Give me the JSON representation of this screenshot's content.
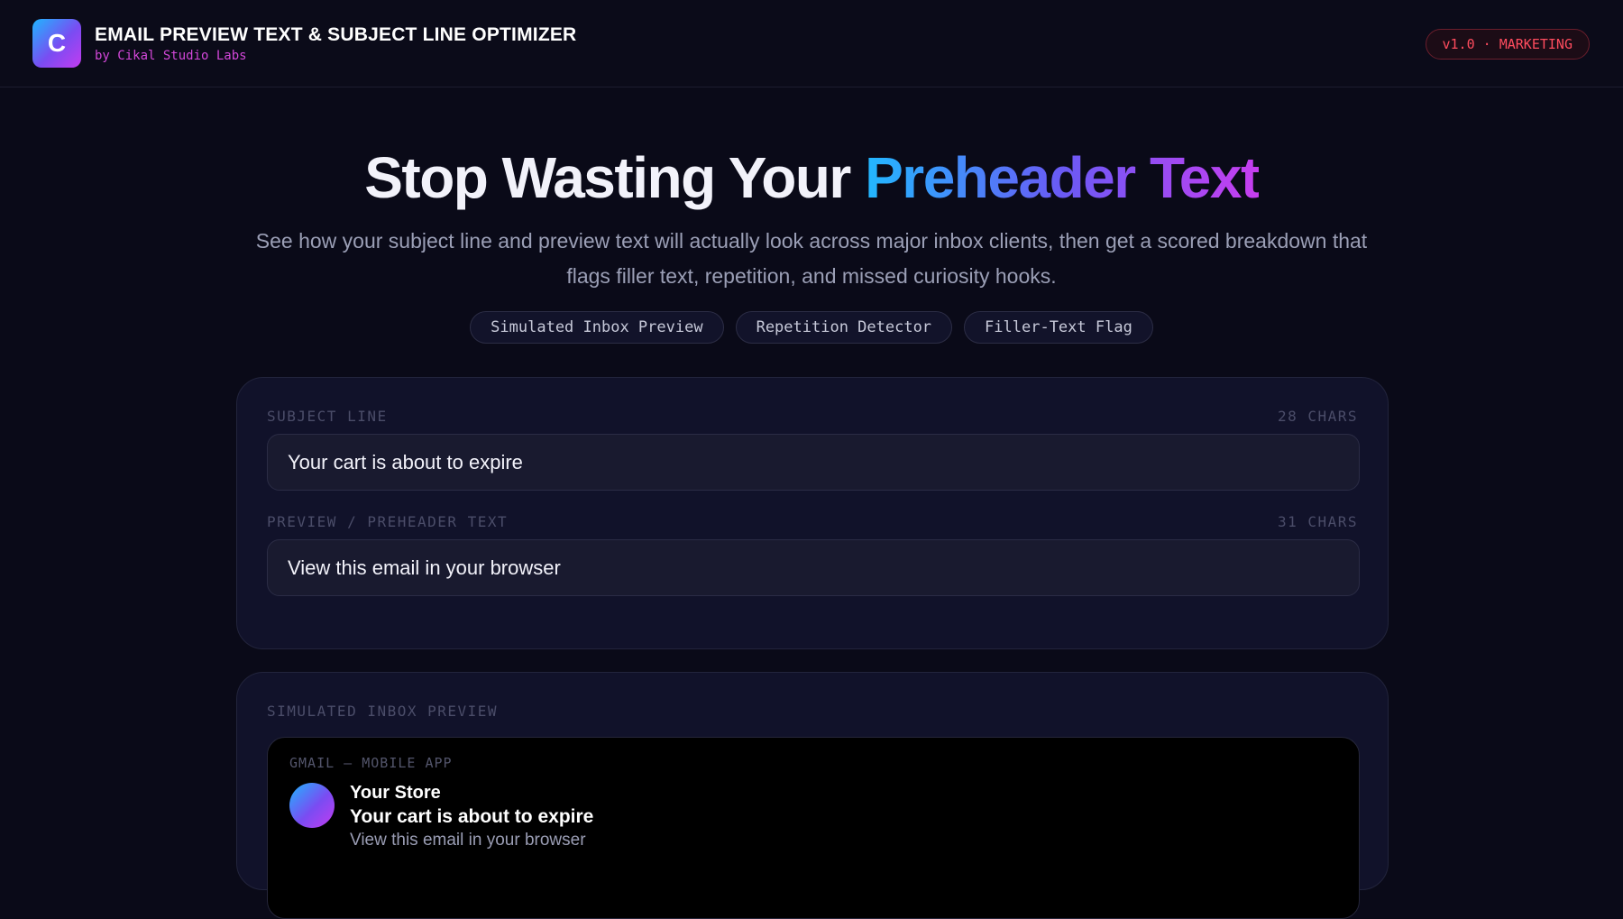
{
  "header": {
    "logo_letter": "C",
    "title": "EMAIL PREVIEW TEXT & SUBJECT LINE OPTIMIZER",
    "byline": "by Cikal Studio Labs",
    "version_badge": "v1.0 · MARKETING"
  },
  "hero": {
    "title_plain": "Stop Wasting Your ",
    "title_highlight": "Preheader Text",
    "subtitle": "See how your subject line and preview text will actually look across major inbox clients, then get a scored breakdown that flags filler text, repetition, and missed curiosity hooks.",
    "chips": [
      "Simulated Inbox Preview",
      "Repetition Detector",
      "Filler-Text Flag"
    ]
  },
  "inputs": {
    "subject": {
      "label": "SUBJECT LINE",
      "count": "28 CHARS",
      "value": "Your cart is about to expire"
    },
    "preheader": {
      "label": "PREVIEW / PREHEADER TEXT",
      "count": "31 CHARS",
      "value": "View this email in your browser"
    }
  },
  "preview": {
    "label": "SIMULATED INBOX PREVIEW",
    "client": "GMAIL — MOBILE APP",
    "sender": "Your Store",
    "subject": "Your cart is about to expire",
    "snippet": "View this email in your browser"
  },
  "colors": {
    "background": "#0a0a18",
    "panel": "#11122a",
    "accent_start": "#22b8ff",
    "accent_end": "#c73ef0",
    "badge_red": "#ff4c5e",
    "byline_pink": "#d247d8"
  }
}
